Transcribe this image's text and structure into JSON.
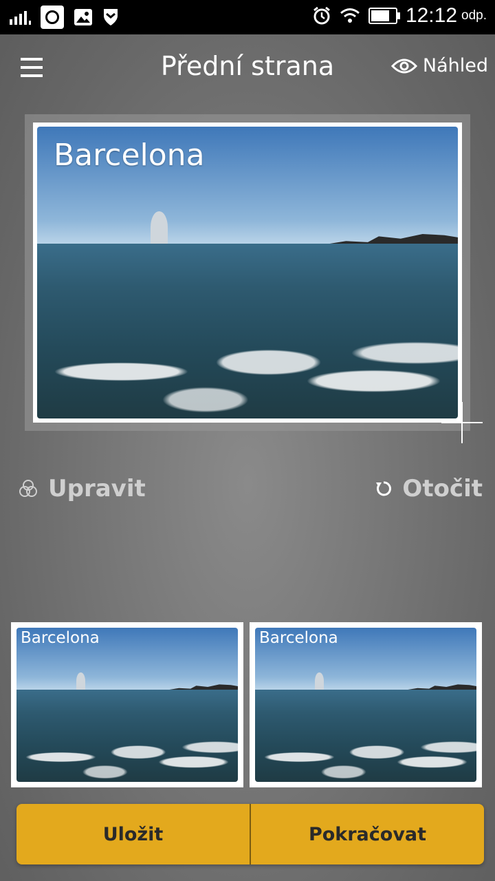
{
  "status_bar": {
    "time": "12:12",
    "suffix": "odp.",
    "icons": [
      "signal-icon",
      "app-notification-icon",
      "image-icon",
      "shield-icon",
      "alarm-icon",
      "wifi-icon",
      "battery-icon"
    ]
  },
  "header": {
    "title": "Přední strana",
    "preview_label": "Náhled",
    "menu_icon": "hamburger-menu-icon",
    "preview_icon": "eye-icon"
  },
  "main_card": {
    "caption": "Barcelona"
  },
  "actions": {
    "edit_label": "Upravit",
    "edit_icon": "filter-circles-icon",
    "rotate_label": "Otočit",
    "rotate_icon": "rotate-icon"
  },
  "thumbnails": [
    {
      "caption": "Barcelona"
    },
    {
      "caption": "Barcelona"
    }
  ],
  "buttons": {
    "save_label": "Uložit",
    "continue_label": "Pokračovat"
  },
  "colors": {
    "accent": "#e3a91d",
    "status_bar": "#000000"
  }
}
